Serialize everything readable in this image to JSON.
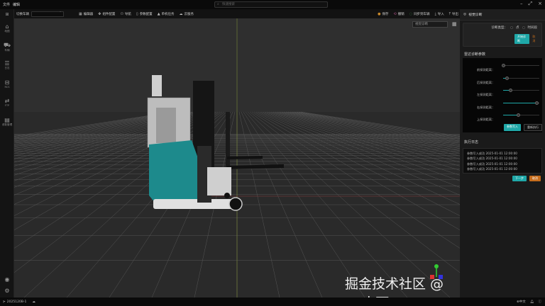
{
  "menu": {
    "items": [
      "文件",
      "编辑"
    ]
  },
  "search": {
    "placeholder": "快速搜索"
  },
  "toolbar": {
    "vehicle_label": "切换车辆",
    "vehicle_value": "",
    "left_items": [
      {
        "icon": "editor-icon",
        "label": "编辑器"
      },
      {
        "icon": "component-icon",
        "label": "组件配置"
      },
      {
        "icon": "navigation-icon",
        "label": "导航"
      },
      {
        "icon": "params-icon",
        "label": "参数配置"
      },
      {
        "icon": "task-icon",
        "label": "单机任务"
      },
      {
        "icon": "cloud-icon",
        "label": "云服务"
      }
    ],
    "right_items": [
      {
        "icon": "save-icon",
        "label": "保存"
      },
      {
        "icon": "undo-icon",
        "label": "撤销"
      },
      {
        "icon": "sync-icon",
        "label": "同步到车辆"
      },
      {
        "icon": "import-icon",
        "label": "导入"
      },
      {
        "icon": "export-icon",
        "label": "导出"
      }
    ]
  },
  "sidebar": {
    "items": [
      {
        "icon": "map-icon",
        "label": "地图"
      },
      {
        "icon": "vehicle-icon",
        "label": "车辆"
      },
      {
        "icon": "log-icon",
        "label": "日志"
      },
      {
        "icon": "rcs-icon",
        "label": "RCS"
      },
      {
        "icon": "ftp-icon",
        "label": "FTP"
      },
      {
        "icon": "param-manage-icon",
        "label": "参数管理"
      }
    ]
  },
  "viewport": {
    "mode_select": "视觉诊断",
    "watermark": "掘金技术社区 @ G_大雨",
    "axes": {
      "y": "Y"
    }
  },
  "panel": {
    "title": "视觉诊断",
    "diag_type_label": "诊断类型：",
    "options": [
      "点",
      "时间段"
    ],
    "start_button": "开始诊断",
    "cancel_button": "取消",
    "radar_title": "雷达诊断参数",
    "sliders": [
      {
        "label": "前探测距离：",
        "value": 0.0
      },
      {
        "label": "后探测距离：",
        "value": 0.1
      },
      {
        "label": "左探测距离：",
        "value": 0.2
      },
      {
        "label": "右探测距离：",
        "value": 0.92
      },
      {
        "label": "上探测距离：",
        "value": 0.42
      }
    ],
    "write_button": "参数写入",
    "rerun_button": "重新执行",
    "log_title": "执行日志",
    "logs": [
      "参数写入成功 2025-01-01 12:00:00",
      "参数写入成功 2025-01-01 12:00:00",
      "参数写入成功 2025-01-01 12:00:00",
      "参数写入成功 2025-01-01 12:00:00"
    ],
    "next_button": "下一步",
    "cancel2_button": "取消"
  },
  "status": {
    "version": "2025120B-1",
    "language": "中文"
  },
  "colors": {
    "accent": "#1fa8a8",
    "warning": "#c56c1c",
    "forklift": "#1d8a8c"
  }
}
